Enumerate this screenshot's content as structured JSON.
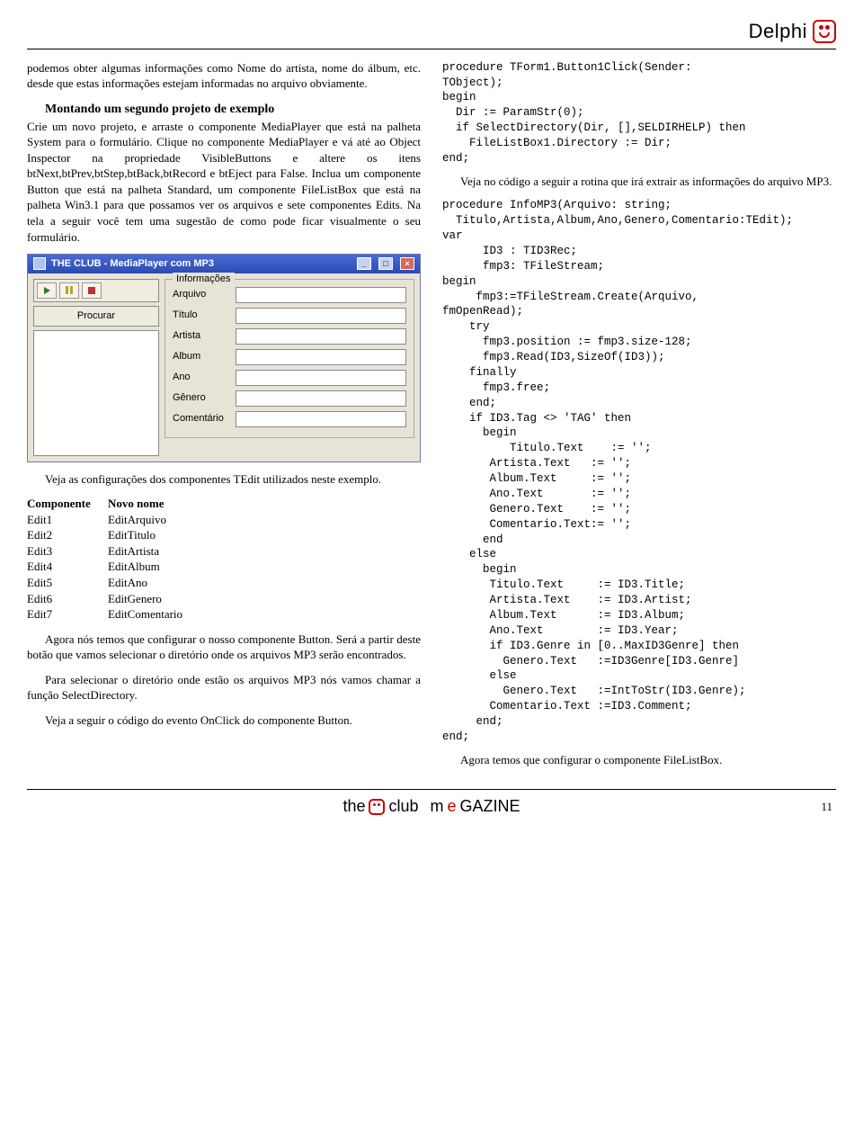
{
  "header": {
    "product": "Delphi"
  },
  "left": {
    "p1": "podemos obter algumas informações como Nome do artista, nome do álbum, etc. desde que estas informações estejam informadas no arquivo obviamente.",
    "h1": "Montando um segundo projeto de exemplo",
    "p2": "Crie um novo projeto, e arraste o componente MediaPlayer que está na palheta System para o formulário. Clique no componente MediaPlayer e vá até ao Object Inspector na propriedade VisibleButtons e altere os itens btNext,btPrev,btStep,btBack,btRecord e btEject para False. Inclua um componente Button que está na palheta Standard, um componente FileListBox que está na palheta Win3.1 para que possamos ver os arquivos e sete componentes Edits. Na tela a seguir você tem uma sugestão de como pode ficar visualmente o seu formulário.",
    "screenshot": {
      "title": "THE CLUB - MediaPlayer com MP3",
      "procurar": "Procurar",
      "group": "Informações",
      "labels": {
        "arquivo": "Arquivo",
        "titulo": "Título",
        "artista": "Artista",
        "album": "Album",
        "ano": "Ano",
        "genero": "Gênero",
        "comentario": "Comentário"
      }
    },
    "p3": "Veja as configurações dos componentes TEdit utilizados neste exemplo.",
    "table": {
      "h1": "Componente",
      "h2": "Novo nome",
      "rows": [
        [
          "Edit1",
          "EditArquivo"
        ],
        [
          "Edit2",
          "EditTitulo"
        ],
        [
          "Edit3",
          "EditArtista"
        ],
        [
          "Edit4",
          "EditAlbum"
        ],
        [
          "Edit5",
          "EditAno"
        ],
        [
          "Edit6",
          "EditGenero"
        ],
        [
          "Edit7",
          "EditComentario"
        ]
      ]
    },
    "p4": "Agora nós temos que configurar o nosso componente Button. Será a partir deste botão que vamos selecionar o diretório onde os arquivos MP3 serão encontrados.",
    "p5": "Para selecionar o diretório onde estão os arquivos MP3 nós vamos chamar a função SelectDirectory.",
    "p6": "Veja a seguir o código do evento OnClick do componente Button."
  },
  "right": {
    "code1": "procedure TForm1.Button1Click(Sender:\nTObject);\nbegin\n  Dir := ParamStr(0);\n  if SelectDirectory(Dir, [],SELDIRHELP) then\n    FileListBox1.Directory := Dir;\nend;",
    "p1": "Veja no código a seguir a rotina que irá extrair as informações do arquivo MP3.",
    "code2": "procedure InfoMP3(Arquivo: string;\n  Titulo,Artista,Album,Ano,Genero,Comentario:TEdit);\nvar\n      ID3 : TID3Rec;\n      fmp3: TFileStream;\nbegin\n     fmp3:=TFileStream.Create(Arquivo,\nfmOpenRead);\n    try\n      fmp3.position := fmp3.size-128;\n      fmp3.Read(ID3,SizeOf(ID3));\n    finally\n      fmp3.free;\n    end;\n    if ID3.Tag <> 'TAG' then\n      begin\n          Titulo.Text    := '';\n       Artista.Text   := '';\n       Album.Text     := '';\n       Ano.Text       := '';\n       Genero.Text    := '';\n       Comentario.Text:= '';\n      end\n    else\n      begin\n       Titulo.Text     := ID3.Title;\n       Artista.Text    := ID3.Artist;\n       Album.Text      := ID3.Album;\n       Ano.Text        := ID3.Year;\n       if ID3.Genre in [0..MaxID3Genre] then\n         Genero.Text   :=ID3Genre[ID3.Genre]\n       else\n         Genero.Text   :=IntToStr(ID3.Genre);\n       Comentario.Text :=ID3.Comment;\n     end;\nend;",
    "p2": "Agora temos que configurar o componente FileListBox."
  },
  "footer": {
    "brand1": "the",
    "brand2": "club",
    "brand3": "m",
    "brand4": "GAZINE",
    "brand_e": "e",
    "page": "11"
  }
}
